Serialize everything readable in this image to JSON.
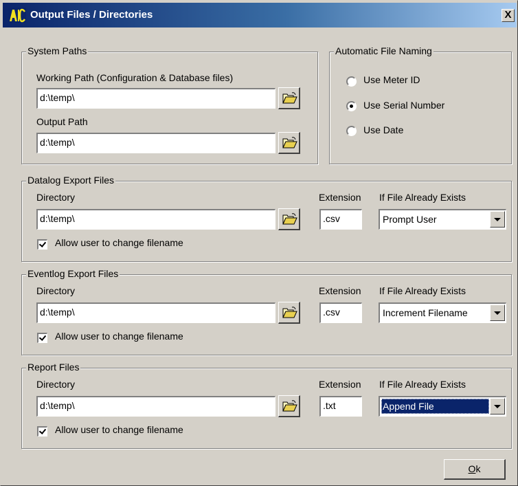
{
  "window": {
    "title": "Output Files / Directories",
    "close_label": "X"
  },
  "system_paths": {
    "legend": "System Paths",
    "working_label": "Working Path (Configuration & Database files)",
    "working_value": "d:\\temp\\",
    "output_label": "Output Path",
    "output_value": "d:\\temp\\"
  },
  "naming": {
    "legend": "Automatic File Naming",
    "options": [
      {
        "label": "Use Meter ID",
        "selected": false
      },
      {
        "label": "Use Serial Number",
        "selected": true
      },
      {
        "label": "Use Date",
        "selected": false
      }
    ]
  },
  "sections": [
    {
      "legend": "Datalog Export Files",
      "dir_label": "Directory",
      "dir_value": "d:\\temp\\",
      "ext_label": "Extension",
      "ext_value": ".csv",
      "exists_label": "If File Already Exists",
      "exists_value": "Prompt User",
      "exists_focused": false,
      "allow_label": "Allow user to change filename",
      "allow_checked": true
    },
    {
      "legend": "Eventlog Export Files",
      "dir_label": "Directory",
      "dir_value": "d:\\temp\\",
      "ext_label": "Extension",
      "ext_value": ".csv",
      "exists_label": "If File Already Exists",
      "exists_value": "Increment Filename",
      "exists_focused": false,
      "allow_label": "Allow user to change filename",
      "allow_checked": true
    },
    {
      "legend": "Report Files",
      "dir_label": "Directory",
      "dir_value": "d:\\temp\\",
      "ext_label": "Extension",
      "ext_value": ".txt",
      "exists_label": "If File Already Exists",
      "exists_value": "Append File",
      "exists_focused": true,
      "allow_label": "Allow user to change filename",
      "allow_checked": true
    }
  ],
  "buttons": {
    "ok_label": "k",
    "ok_mnemonic": "O"
  },
  "icons": {
    "browse": "open-folder-icon",
    "app": "app-logo-icon",
    "close": "close-icon"
  },
  "colors": {
    "title_start": "#0a246a",
    "title_end": "#a6caf0",
    "face": "#d4d0c8",
    "selection": "#0a246a"
  }
}
